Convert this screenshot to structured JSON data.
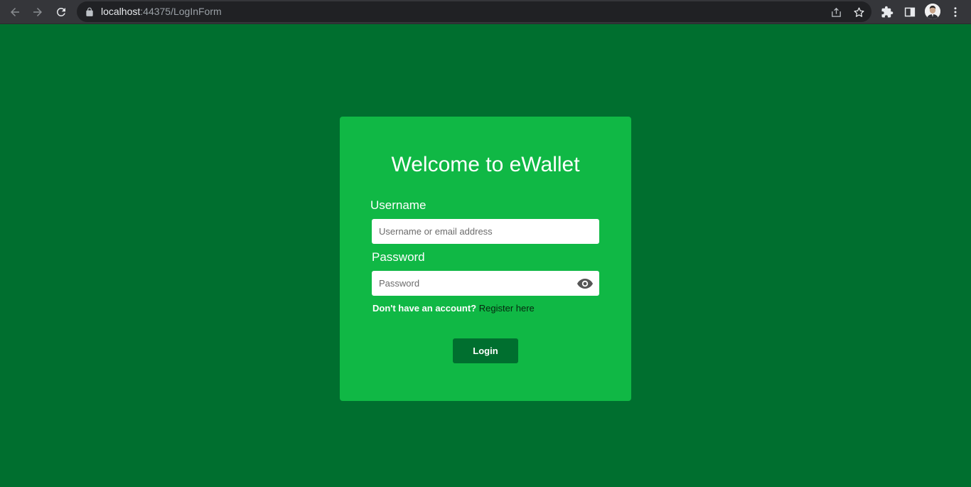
{
  "browser": {
    "url_host": "localhost",
    "url_rest": ":44375/LogInForm",
    "icons": {
      "back": "arrow-left-icon",
      "forward": "arrow-right-icon",
      "reload": "reload-icon",
      "lock": "lock-icon",
      "share": "share-icon",
      "bookmark": "star-icon",
      "extensions": "puzzle-icon",
      "side_panel": "side-panel-icon",
      "profile": "avatar",
      "menu": "kebab-menu-icon"
    }
  },
  "colors": {
    "page_background": "#006f2f",
    "card_background": "#10b845",
    "button_background": "#006f2f",
    "link_color": "#06270f"
  },
  "login": {
    "title": "Welcome to eWallet",
    "username_label": "Username",
    "username_placeholder": "Username or email address",
    "username_value": "",
    "password_label": "Password",
    "password_placeholder": "Password",
    "password_value": "",
    "register_prompt": "Don't have an account?",
    "register_link": "Register here",
    "login_button": "Login"
  }
}
